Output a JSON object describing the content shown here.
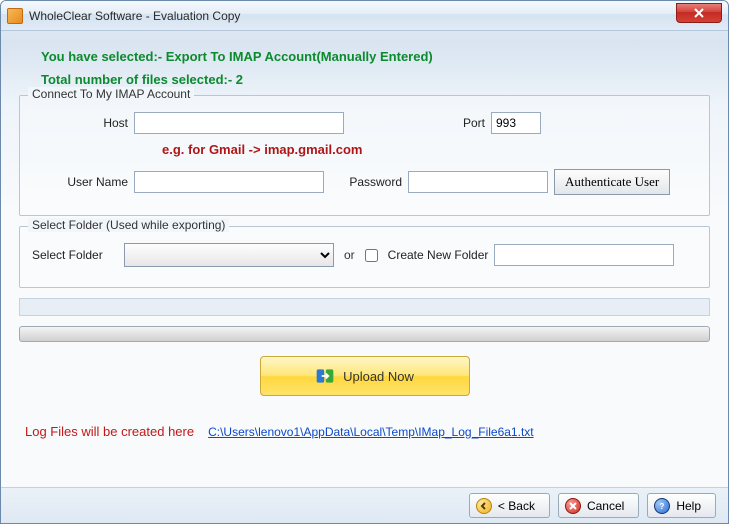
{
  "window": {
    "title": "WholeClear Software - Evaluation Copy"
  },
  "header": {
    "selected_line": "You have selected:- Export To IMAP Account(Manually Entered)",
    "count_line": "Total number of files selected:- 2"
  },
  "imap": {
    "legend": "Connect To My IMAP Account",
    "host_label": "Host",
    "host_value": "",
    "port_label": "Port",
    "port_value": "993",
    "hint": "e.g. for Gmail -> imap.gmail.com",
    "user_label": "User Name",
    "user_value": "",
    "pass_label": "Password",
    "pass_value": "",
    "auth_button": "Authenticate User"
  },
  "folder": {
    "legend": "Select Folder (Used while exporting)",
    "select_label": "Select Folder",
    "or": "or",
    "create_label": "Create New Folder",
    "create_value": ""
  },
  "upload": {
    "label": "Upload Now"
  },
  "log": {
    "label": "Log Files will be created here",
    "path": "C:\\Users\\lenovo1\\AppData\\Local\\Temp\\IMap_Log_File6a1.txt"
  },
  "footer": {
    "back": "< Back",
    "cancel": "Cancel",
    "help": "Help"
  }
}
